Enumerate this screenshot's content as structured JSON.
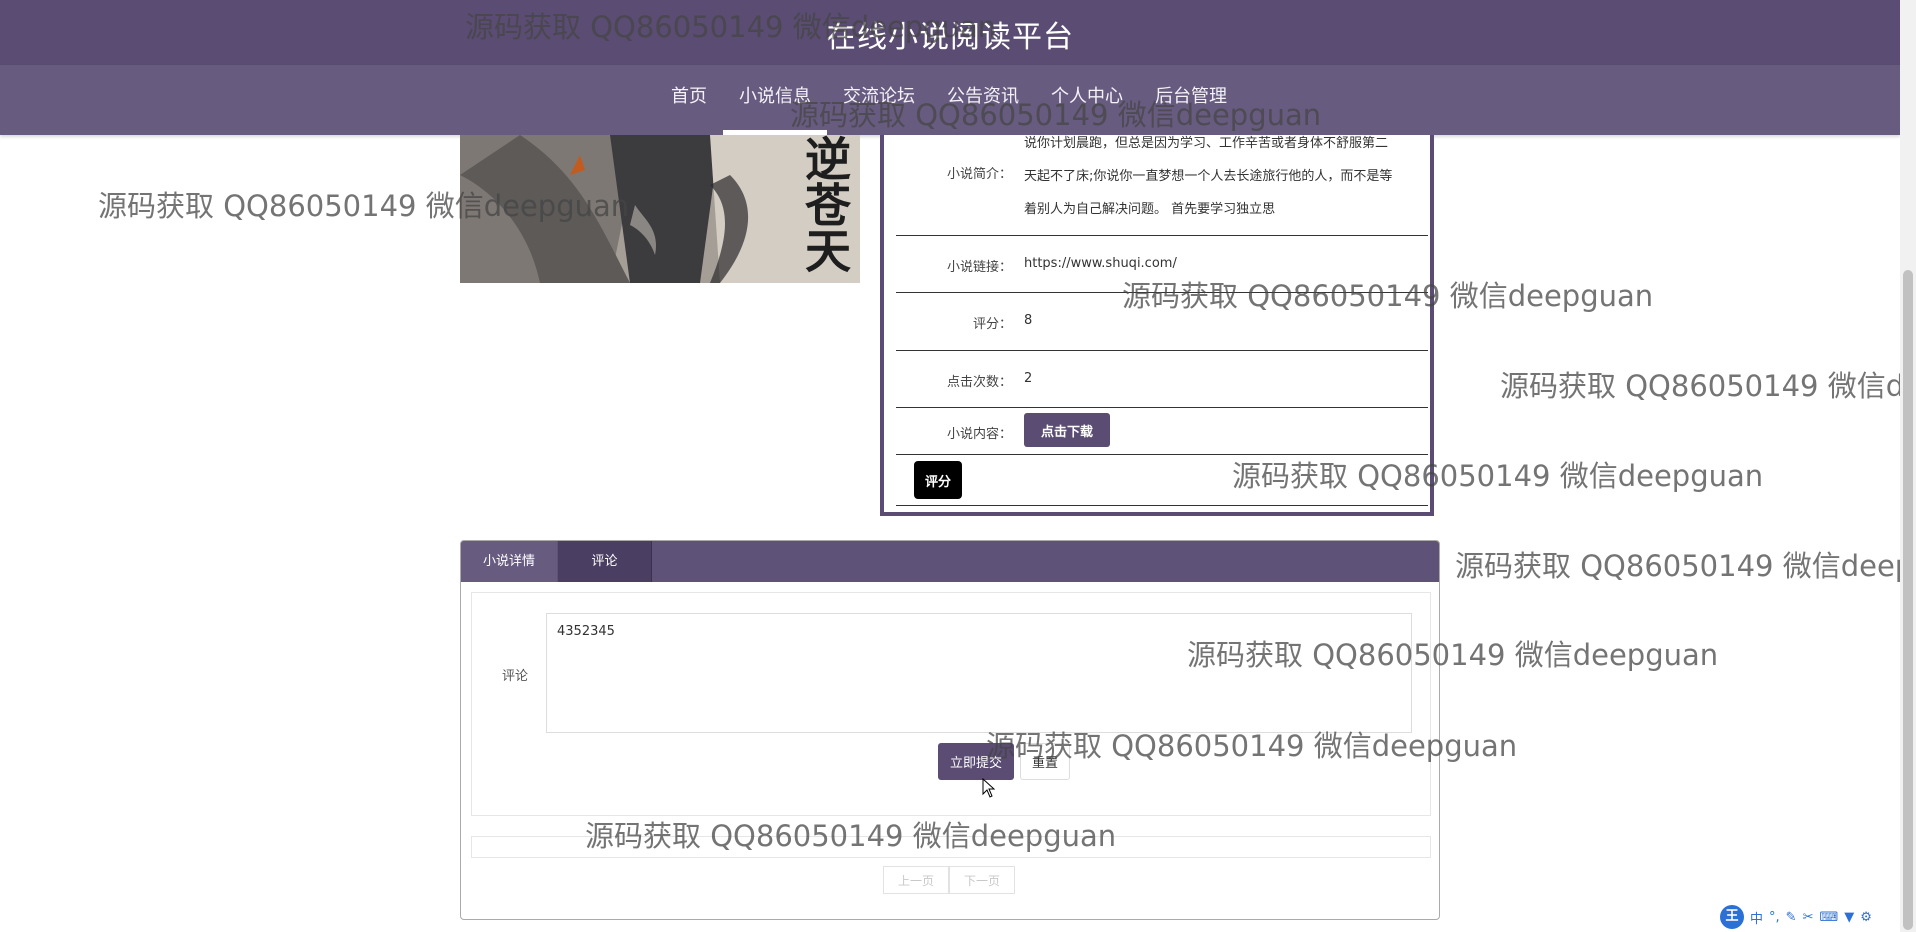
{
  "site": {
    "title": "在线小说阅读平台"
  },
  "nav": {
    "items": [
      {
        "label": "首页"
      },
      {
        "label": "小说信息",
        "active": true
      },
      {
        "label": "交流论坛"
      },
      {
        "label": "公告资讯"
      },
      {
        "label": "个人中心"
      },
      {
        "label": "后台管理"
      }
    ]
  },
  "cover": {
    "text": "逆苍天"
  },
  "info": {
    "intro": {
      "label": "小说简介：",
      "line1": "说你计划晨跑，但总是因为学习、工作辛苦或者身体不舒服第二",
      "line2": "天起不了床;你说你一直梦想一个人去长途旅行他的人，而不是等",
      "line3": "着别人为自己解决问题。 首先要学习独立思"
    },
    "link": {
      "label": "小说链接：",
      "value": "https://www.shuqi.com/"
    },
    "score": {
      "label": "评分：",
      "value": "8"
    },
    "clicks": {
      "label": "点击次数：",
      "value": "2"
    },
    "content": {
      "label": "小说内容：",
      "download_button": "点击下载"
    },
    "rate_button": "评分"
  },
  "tabs": {
    "items": [
      {
        "label": "小说详情"
      },
      {
        "label": "评论"
      }
    ],
    "comment_form": {
      "label": "评论",
      "value": "4352345",
      "submit_button": "立即提交",
      "reset_button": "重置"
    },
    "pager": {
      "prev": "上一页",
      "next": "下一页"
    }
  },
  "watermark": "源码获取 QQ86050149 微信deepguan",
  "ime": {
    "logo": "王",
    "mode": "中"
  },
  "colors": {
    "header": "#5a4c72",
    "nav": "#675b80",
    "accent": "#5a4c72"
  }
}
